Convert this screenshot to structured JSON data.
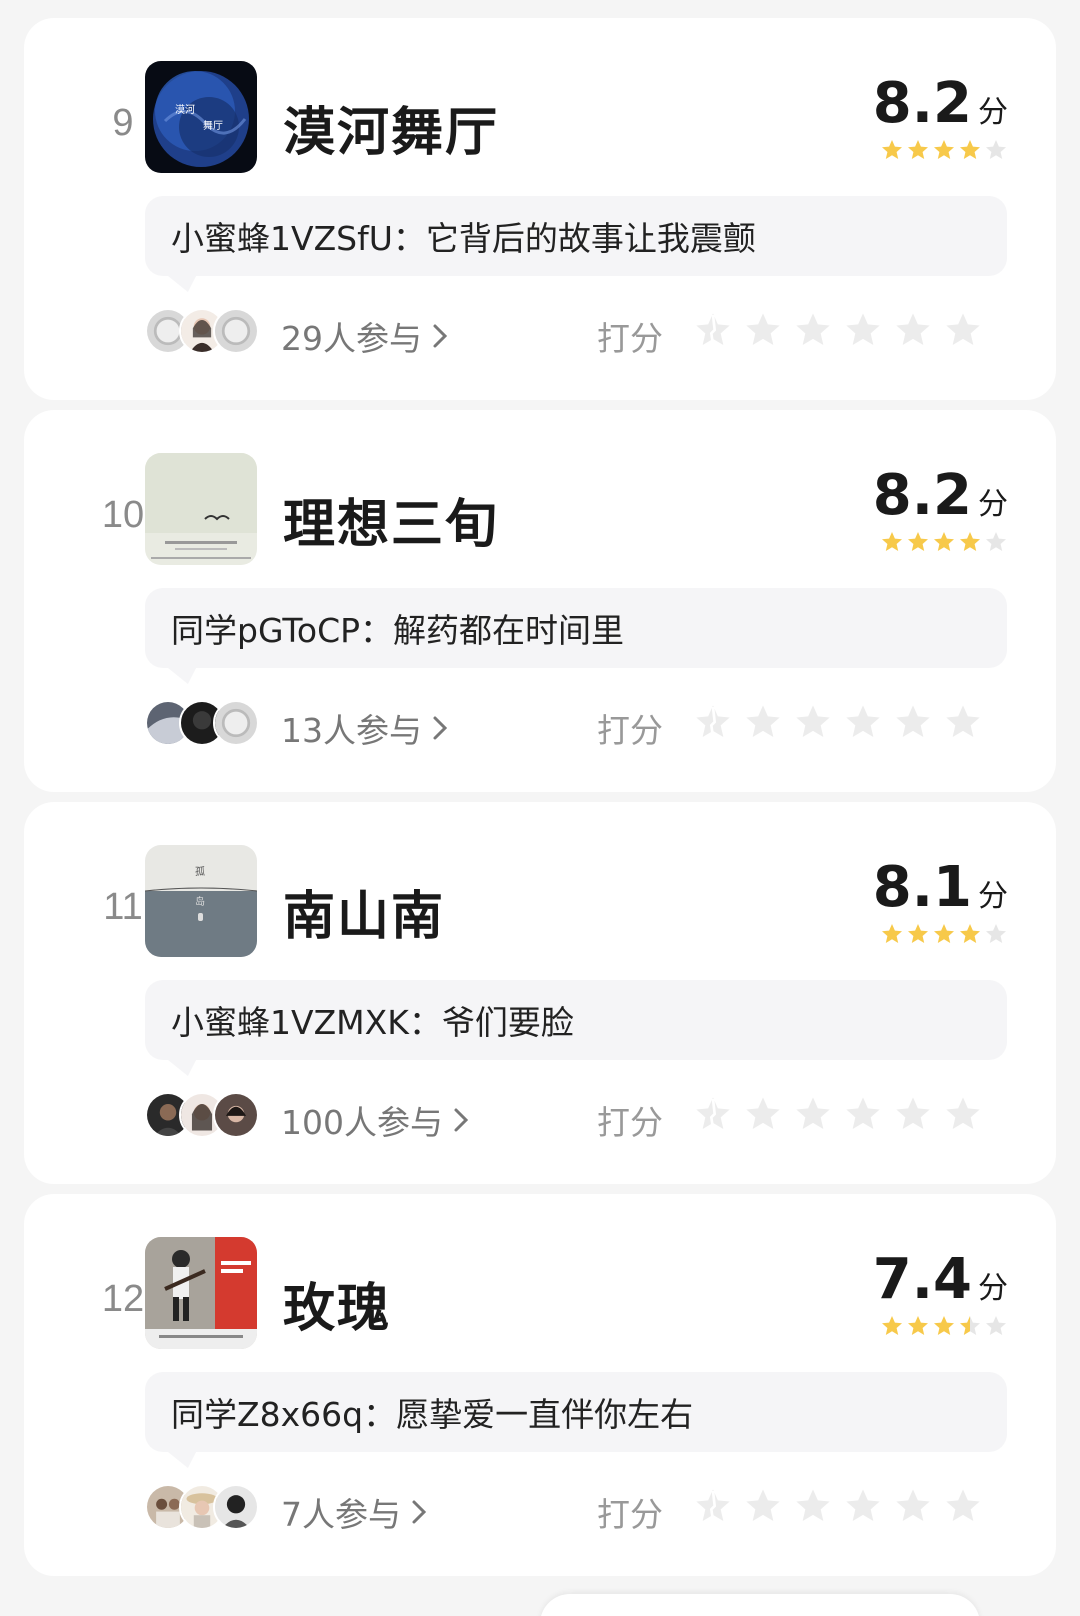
{
  "score_unit": "分",
  "participants_suffix": "人参与",
  "rate_label": "打分",
  "colors": {
    "star": "#f7c94a",
    "star_empty": "#e6e6e6",
    "card": "#ffffff",
    "bg": "#f5f5f5"
  },
  "items": [
    {
      "rank": "9",
      "title": "漠河舞厅",
      "score": "8.2",
      "stars": 4,
      "comment": "小蜜蜂1VZSfU：它背后的故事让我震颤",
      "participants": "29",
      "cover_icon": "blue-planet-cover"
    },
    {
      "rank": "10",
      "title": "理想三旬",
      "score": "8.2",
      "stars": 4,
      "comment": "同学pGToCP：解药都在时间里",
      "participants": "13",
      "cover_icon": "pale-bird-cover"
    },
    {
      "rank": "11",
      "title": "南山南",
      "score": "8.1",
      "stars": 4,
      "comment": "小蜜蜂1VZMXK：爷们要脸",
      "participants": "100",
      "cover_icon": "grey-sea-cover"
    },
    {
      "rank": "12",
      "title": "玫瑰",
      "score": "7.4",
      "stars": 3.5,
      "comment": "同学Z8x66q：愿挚爱一直伴你左右",
      "participants": "7",
      "cover_icon": "guitar-photo-cover"
    }
  ]
}
